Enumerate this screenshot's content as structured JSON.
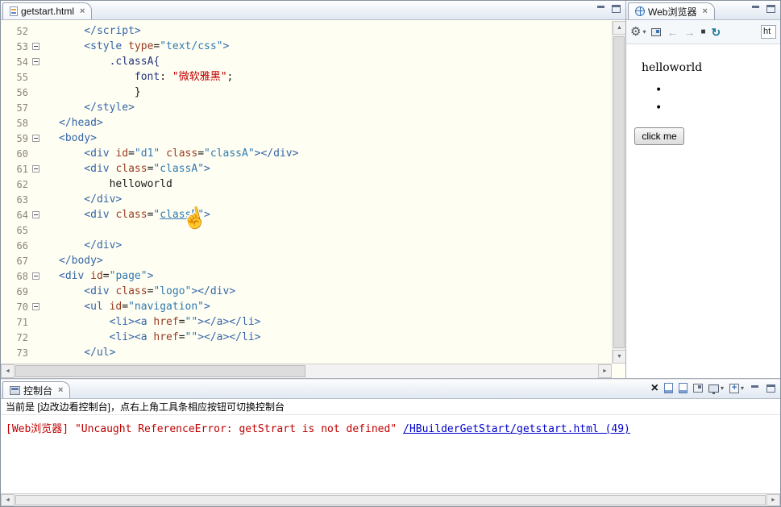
{
  "editor": {
    "tab": {
      "title": "getstart.html"
    },
    "code": {
      "lines": [
        {
          "n": 52,
          "fold": false,
          "indent": 4,
          "tok": [
            [
              "tag",
              "</script>"
            ]
          ]
        },
        {
          "n": 53,
          "fold": true,
          "indent": 4,
          "tok": [
            [
              "tag",
              "<style"
            ],
            [
              "plain",
              " "
            ],
            [
              "attr",
              "type"
            ],
            [
              "plain",
              "="
            ],
            [
              "val",
              "\"text/css\""
            ],
            [
              "tag",
              ">"
            ]
          ]
        },
        {
          "n": 54,
          "fold": true,
          "indent": 8,
          "tok": [
            [
              "sel",
              ".classA{"
            ]
          ]
        },
        {
          "n": 55,
          "fold": false,
          "indent": 12,
          "tok": [
            [
              "prop",
              "font"
            ],
            [
              "plain",
              ": "
            ],
            [
              "str",
              "\"微软雅黑\""
            ],
            [
              "plain",
              ";"
            ]
          ]
        },
        {
          "n": 56,
          "fold": false,
          "indent": 12,
          "tok": [
            [
              "plain",
              "}"
            ]
          ]
        },
        {
          "n": 57,
          "fold": false,
          "indent": 4,
          "tok": [
            [
              "tag",
              "</style>"
            ]
          ]
        },
        {
          "n": 58,
          "fold": false,
          "indent": 0,
          "tok": [
            [
              "tag",
              "</head>"
            ]
          ]
        },
        {
          "n": 59,
          "fold": true,
          "indent": 0,
          "tok": [
            [
              "tag",
              "<body>"
            ]
          ]
        },
        {
          "n": 60,
          "fold": false,
          "indent": 4,
          "tok": [
            [
              "tag",
              "<div"
            ],
            [
              "plain",
              " "
            ],
            [
              "attr",
              "id"
            ],
            [
              "plain",
              "="
            ],
            [
              "val",
              "\"d1\""
            ],
            [
              "plain",
              " "
            ],
            [
              "attr",
              "class"
            ],
            [
              "plain",
              "="
            ],
            [
              "val",
              "\"classA\""
            ],
            [
              "tag",
              "></div>"
            ]
          ]
        },
        {
          "n": 61,
          "fold": true,
          "indent": 4,
          "tok": [
            [
              "tag",
              "<div"
            ],
            [
              "plain",
              " "
            ],
            [
              "attr",
              "class"
            ],
            [
              "plain",
              "="
            ],
            [
              "val",
              "\"classA\""
            ],
            [
              "tag",
              ">"
            ]
          ]
        },
        {
          "n": 62,
          "fold": false,
          "indent": 8,
          "tok": [
            [
              "plain",
              "helloworld"
            ]
          ]
        },
        {
          "n": 63,
          "fold": false,
          "indent": 4,
          "tok": [
            [
              "tag",
              "</div>"
            ]
          ]
        },
        {
          "n": 64,
          "fold": true,
          "indent": 4,
          "tok": [
            [
              "tag",
              "<div"
            ],
            [
              "plain",
              " "
            ],
            [
              "attr",
              "class"
            ],
            [
              "plain",
              "="
            ],
            [
              "val",
              "\""
            ],
            [
              "link",
              "classB"
            ],
            [
              "val",
              "\""
            ],
            [
              "tag",
              ">"
            ]
          ]
        },
        {
          "n": 65,
          "fold": false,
          "indent": 0,
          "tok": []
        },
        {
          "n": 66,
          "fold": false,
          "indent": 4,
          "tok": [
            [
              "tag",
              "</div>"
            ]
          ]
        },
        {
          "n": 67,
          "fold": false,
          "indent": 0,
          "tok": [
            [
              "tag",
              "</body>"
            ]
          ]
        },
        {
          "n": 68,
          "fold": true,
          "indent": 0,
          "tok": [
            [
              "tag",
              "<div"
            ],
            [
              "plain",
              " "
            ],
            [
              "attr",
              "id"
            ],
            [
              "plain",
              "="
            ],
            [
              "val",
              "\"page\""
            ],
            [
              "tag",
              ">"
            ]
          ]
        },
        {
          "n": 69,
          "fold": false,
          "indent": 4,
          "tok": [
            [
              "tag",
              "<div"
            ],
            [
              "plain",
              " "
            ],
            [
              "attr",
              "class"
            ],
            [
              "plain",
              "="
            ],
            [
              "val",
              "\"logo\""
            ],
            [
              "tag",
              "></div>"
            ]
          ]
        },
        {
          "n": 70,
          "fold": true,
          "indent": 4,
          "tok": [
            [
              "tag",
              "<ul"
            ],
            [
              "plain",
              " "
            ],
            [
              "attr",
              "id"
            ],
            [
              "plain",
              "="
            ],
            [
              "val",
              "\"navigation\""
            ],
            [
              "tag",
              ">"
            ]
          ]
        },
        {
          "n": 71,
          "fold": false,
          "indent": 8,
          "tok": [
            [
              "tag",
              "<li><a"
            ],
            [
              "plain",
              " "
            ],
            [
              "attr",
              "href"
            ],
            [
              "plain",
              "="
            ],
            [
              "val",
              "\"\""
            ],
            [
              "tag",
              "></a></li>"
            ]
          ]
        },
        {
          "n": 72,
          "fold": false,
          "indent": 8,
          "tok": [
            [
              "tag",
              "<li><a"
            ],
            [
              "plain",
              " "
            ],
            [
              "attr",
              "href"
            ],
            [
              "plain",
              "="
            ],
            [
              "val",
              "\"\""
            ],
            [
              "tag",
              "></a></li>"
            ]
          ]
        },
        {
          "n": 73,
          "fold": false,
          "indent": 4,
          "tok": [
            [
              "tag",
              "</ul>"
            ]
          ]
        }
      ]
    }
  },
  "browser": {
    "tab": {
      "title": "Web浏览器"
    },
    "toolbar": {
      "url_value": "ht"
    },
    "content": {
      "heading": "helloworld",
      "bullet_count": 2,
      "button_label": "click me"
    }
  },
  "console": {
    "tab": {
      "title": "控制台"
    },
    "info_line": "当前是 [边改边看控制台]，点右上角工具条相应按钮可切换控制台",
    "error": {
      "message": "[Web浏览器] \"Uncaught ReferenceError: getStrart is not defined\"",
      "link": "/HBuilderGetStart/getstart.html (49)"
    }
  }
}
